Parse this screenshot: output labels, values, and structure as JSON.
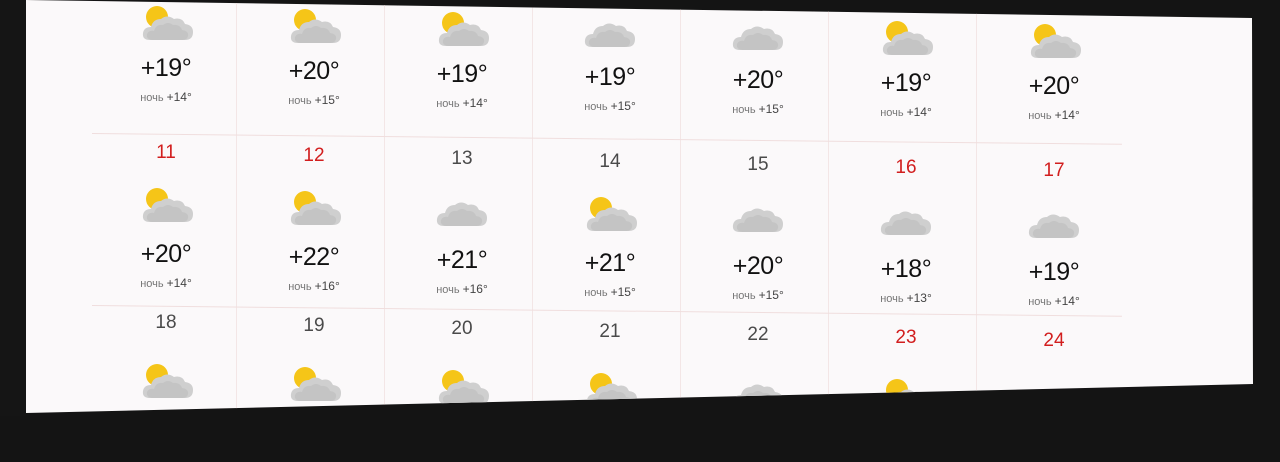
{
  "rows": [
    {
      "cells": [
        {
          "day": "",
          "holiday": false,
          "icon": "sun-cloud-icon",
          "temp": "+19°",
          "night_label": "ночь",
          "night": "+14°"
        },
        {
          "day": "",
          "holiday": false,
          "icon": "sun-cloud-icon",
          "temp": "+20°",
          "night_label": "ночь",
          "night": "+15°"
        },
        {
          "day": "",
          "holiday": false,
          "icon": "sun-cloud-icon",
          "temp": "+19°",
          "night_label": "ночь",
          "night": "+14°"
        },
        {
          "day": "",
          "holiday": false,
          "icon": "cloud-icon",
          "temp": "+19°",
          "night_label": "ночь",
          "night": "+15°"
        },
        {
          "day": "",
          "holiday": false,
          "icon": "cloud-icon",
          "temp": "+20°",
          "night_label": "ночь",
          "night": "+15°"
        },
        {
          "day": "",
          "holiday": false,
          "icon": "sun-cloud-icon",
          "temp": "+19°",
          "night_label": "ночь",
          "night": "+14°"
        },
        {
          "day": "",
          "holiday": false,
          "icon": "sun-cloud-icon",
          "temp": "+20°",
          "night_label": "ночь",
          "night": "+14°"
        }
      ]
    },
    {
      "cells": [
        {
          "day": "11",
          "holiday": true,
          "icon": "sun-cloud-icon",
          "temp": "+20°",
          "night_label": "ночь",
          "night": "+14°"
        },
        {
          "day": "12",
          "holiday": true,
          "icon": "sun-cloud-icon",
          "temp": "+22°",
          "night_label": "ночь",
          "night": "+16°"
        },
        {
          "day": "13",
          "holiday": false,
          "icon": "cloud-icon",
          "temp": "+21°",
          "night_label": "ночь",
          "night": "+16°"
        },
        {
          "day": "14",
          "holiday": false,
          "icon": "sun-cloud-icon",
          "temp": "+21°",
          "night_label": "ночь",
          "night": "+15°"
        },
        {
          "day": "15",
          "holiday": false,
          "icon": "cloud-icon",
          "temp": "+20°",
          "night_label": "ночь",
          "night": "+15°"
        },
        {
          "day": "16",
          "holiday": true,
          "icon": "cloud-icon",
          "temp": "+18°",
          "night_label": "ночь",
          "night": "+13°"
        },
        {
          "day": "17",
          "holiday": true,
          "icon": "cloud-icon",
          "temp": "+19°",
          "night_label": "ночь",
          "night": "+14°"
        }
      ]
    },
    {
      "cells": [
        {
          "day": "18",
          "holiday": false,
          "icon": "sun-cloud-icon",
          "temp": "",
          "night_label": "",
          "night": ""
        },
        {
          "day": "19",
          "holiday": false,
          "icon": "sun-cloud-icon",
          "temp": "",
          "night_label": "",
          "night": ""
        },
        {
          "day": "20",
          "holiday": false,
          "icon": "sun-cloud-icon",
          "temp": "",
          "night_label": "",
          "night": ""
        },
        {
          "day": "21",
          "holiday": false,
          "icon": "sun-cloud-icon",
          "temp": "",
          "night_label": "",
          "night": ""
        },
        {
          "day": "22",
          "holiday": false,
          "icon": "cloud-icon",
          "temp": "",
          "night_label": "",
          "night": ""
        },
        {
          "day": "23",
          "holiday": true,
          "icon": "sun-cloud-icon",
          "temp": "",
          "night_label": "",
          "night": ""
        },
        {
          "day": "24",
          "holiday": true,
          "icon": "cloud-icon",
          "temp": "",
          "night_label": "",
          "night": ""
        }
      ]
    }
  ],
  "colors": {
    "holiday": "#d21e1e",
    "weekday": "#4a4a4a",
    "sun": "#f5c518",
    "cloud": "#c8c8c8"
  }
}
